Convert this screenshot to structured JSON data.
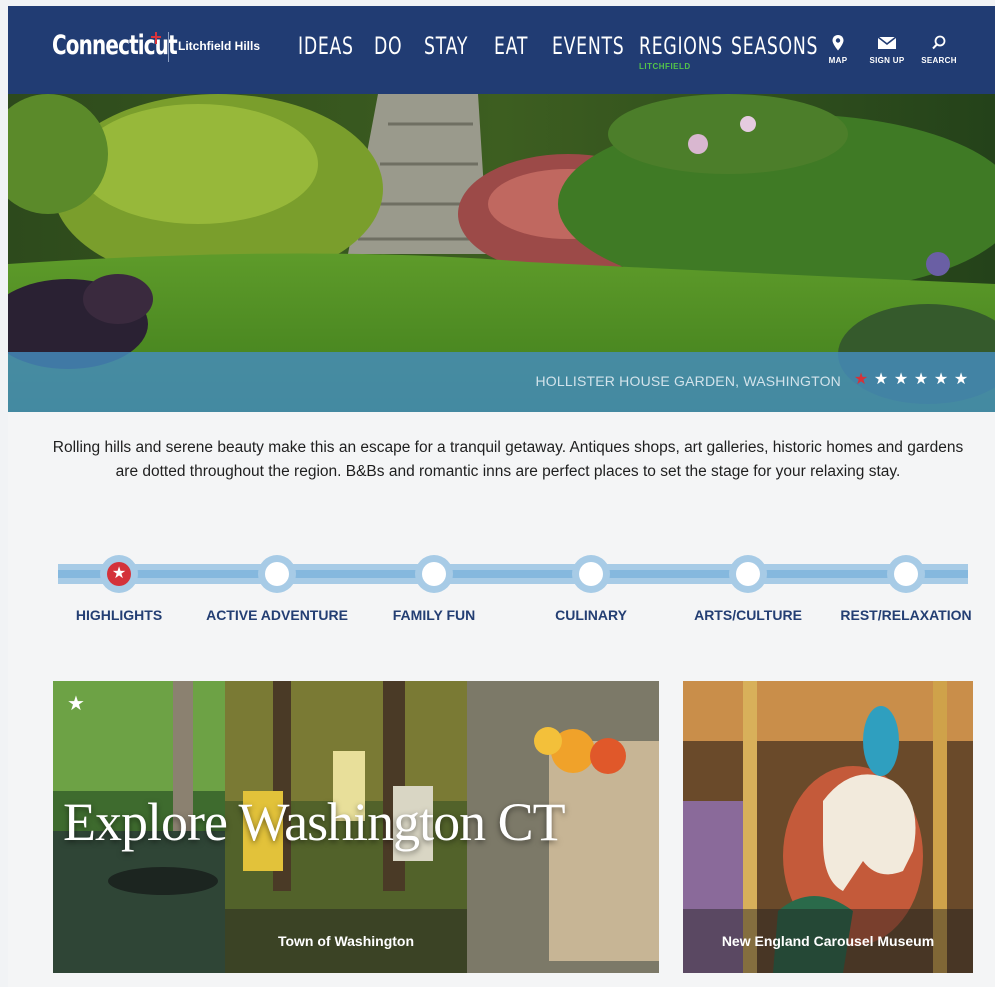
{
  "nav": {
    "logo": "Connecticut",
    "region": "Litchfield Hills",
    "menu": [
      "IDEAS",
      "DO",
      "STAY",
      "EAT",
      "EVENTS",
      "REGIONS",
      "SEASONS"
    ],
    "regions_sub": "LITCHFIELD",
    "utilities": [
      {
        "label": "MAP",
        "icon": "map-pin-icon"
      },
      {
        "label": "SIGN UP",
        "icon": "envelope-icon"
      },
      {
        "label": "SEARCH",
        "icon": "search-icon"
      }
    ]
  },
  "hero": {
    "caption": "HOLLISTER HOUSE GARDEN, WASHINGTON",
    "slide_count": 6,
    "active_slide": 1
  },
  "intro": "Rolling hills and serene beauty make this an escape for a tranquil getaway. Antiques shops, art galleries, historic homes and gardens are dotted throughout the region. B&Bs and romantic inns are perfect places to set the stage for your relaxing stay.",
  "tabs": [
    "HIGHLIGHTS",
    "ACTIVE ADVENTURE",
    "FAMILY FUN",
    "CULINARY",
    "ARTS/CULTURE",
    "REST/RELAXATION"
  ],
  "active_tab": 0,
  "cards": [
    {
      "overlay_title": "Explore Washington CT",
      "caption": "Town of Washington",
      "featured": true
    },
    {
      "caption": "New England Carousel Museum",
      "featured": false
    }
  ],
  "colors": {
    "nav": "#213c73",
    "accent_red": "#d4323a",
    "accent_green": "#53c34a",
    "timeline": "#a7cbe6"
  }
}
